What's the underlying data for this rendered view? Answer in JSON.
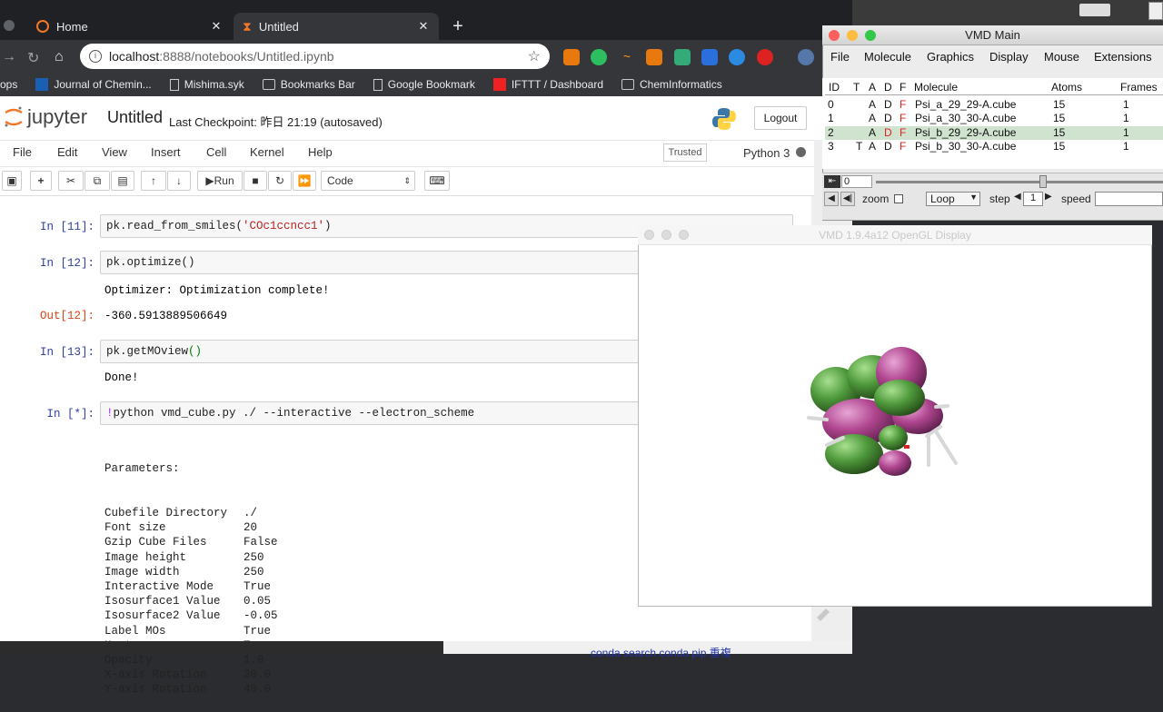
{
  "browser": {
    "tabs": [
      {
        "label": "Home"
      },
      {
        "label": "Untitled"
      }
    ],
    "new_tab": "+",
    "url_host": "localhost",
    "url_path": ":8888/notebooks/Untitled.ipynb",
    "bookmarks": [
      "ops",
      "Journal of Chemin...",
      "Mishima.syk",
      "Bookmarks Bar",
      "Google Bookmark",
      "IFTTT / Dashboard",
      "ChemInformatics"
    ]
  },
  "jupyter": {
    "logo_text": "jupyter",
    "notebook_name": "Untitled",
    "checkpoint": "Last Checkpoint: 昨日 21:19  (autosaved)",
    "logout": "Logout",
    "menu": [
      "File",
      "Edit",
      "View",
      "Insert",
      "Cell",
      "Kernel",
      "Help"
    ],
    "trusted": "Trusted",
    "kernel": "Python 3",
    "run_label": "Run",
    "cell_type": "Code",
    "cells": {
      "c11_prompt": "In [11]:",
      "c11_code_a": "pk.read_from_smiles(",
      "c11_code_str": "'COc1ccncc1'",
      "c11_code_b": ")",
      "c12_prompt": "In [12]:",
      "c12_code": "pk.optimize()",
      "c12_stdout": "Optimizer: Optimization complete!",
      "c12_out_prompt": "Out[12]:",
      "c12_out": "-360.5913889506649",
      "c13_prompt": "In [13]:",
      "c13_code_a": "pk.getMOview",
      "c13_code_b": "()",
      "c13_stdout": "Done!",
      "cstar_prompt": "In [*]:",
      "cstar_bang": "!",
      "cstar_code": "python vmd_cube.py ./ --interactive --electron_scheme",
      "params_header": "Parameters:"
    },
    "params": [
      [
        "Cubefile Directory",
        "./"
      ],
      [
        "Font size",
        "20"
      ],
      [
        "Gzip Cube Files",
        "False"
      ],
      [
        "Image height",
        "250"
      ],
      [
        "Image width",
        "250"
      ],
      [
        "Interactive Mode",
        "True"
      ],
      [
        "Isosurface1 Value",
        "0.05"
      ],
      [
        "Isosurface2 Value",
        "-0.05"
      ],
      [
        "Label MOs",
        "True"
      ],
      [
        "Montage",
        "True"
      ],
      [
        "Opacity",
        "1.0"
      ],
      [
        "X-axis Rotation",
        "30.0"
      ],
      [
        "Y-axis Rotation",
        "40.0"
      ]
    ]
  },
  "vmd_main": {
    "title": "VMD Main",
    "menu": [
      "File",
      "Molecule",
      "Graphics",
      "Display",
      "Mouse",
      "Extensions"
    ],
    "headers": [
      "ID",
      "T",
      "A",
      "D",
      "F",
      "Molecule",
      "Atoms",
      "Frames"
    ],
    "rows": [
      {
        "id": "0",
        "t": "",
        "a": "A",
        "d": "D",
        "f": "F",
        "name": "Psi_a_29_29-A.cube",
        "atoms": "15",
        "frames": "1"
      },
      {
        "id": "1",
        "t": "",
        "a": "A",
        "d": "D",
        "f": "F",
        "name": "Psi_a_30_30-A.cube",
        "atoms": "15",
        "frames": "1"
      },
      {
        "id": "2",
        "t": "",
        "a": "A",
        "d": "D",
        "f": "F",
        "name": "Psi_b_29_29-A.cube",
        "atoms": "15",
        "frames": "1"
      },
      {
        "id": "3",
        "t": "T",
        "a": "A",
        "d": "D",
        "f": "F",
        "name": "Psi_b_30_30-A.cube",
        "atoms": "15",
        "frames": "1"
      }
    ],
    "frame_value": "0",
    "zoom_label": "zoom",
    "loop_label": "Loop",
    "step_label": "step",
    "step_value": "1",
    "speed_label": "speed"
  },
  "opengl": {
    "title": "VMD 1.9.4a12 OpenGL Display"
  },
  "bottom": {
    "links": "conda search        conda pip 重複"
  },
  "colors": {
    "orbital_magenta": "#b0458f",
    "orbital_green": "#4f9a3c",
    "jupyter_orange": "#f37726"
  }
}
